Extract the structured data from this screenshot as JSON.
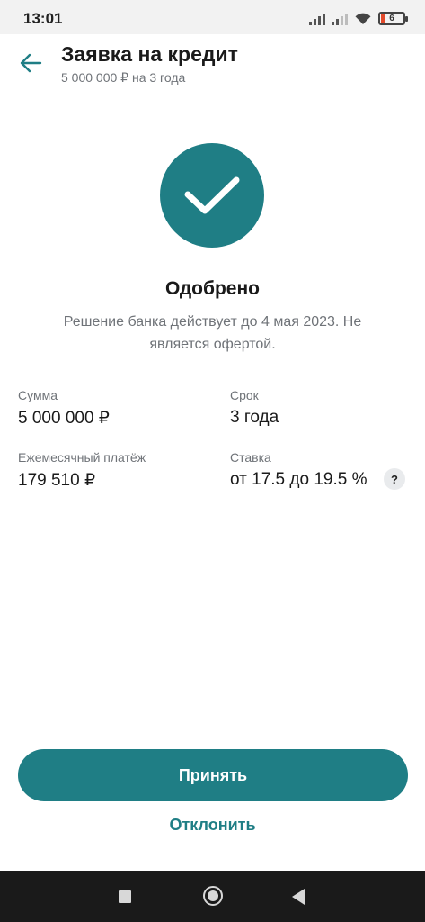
{
  "status_bar": {
    "time": "13:01",
    "battery_level": "6",
    "icons": [
      "signal-icon",
      "signal-weak-icon",
      "wifi-icon",
      "battery-icon"
    ]
  },
  "header": {
    "back_icon": "arrow-left-icon",
    "title": "Заявка на кредит",
    "subtitle": "5 000 000 ₽ на 3 года"
  },
  "status": {
    "icon": "checkmark-icon",
    "heading": "Одобрено",
    "description": "Решение банка действует до 4 мая 2023. Не является офертой."
  },
  "details": {
    "amount": {
      "label": "Сумма",
      "value": "5 000 000 ₽"
    },
    "term": {
      "label": "Срок",
      "value": "3 года"
    },
    "monthly_payment": {
      "label": "Ежемесячный платёж",
      "value": "179 510 ₽"
    },
    "rate": {
      "label": "Ставка",
      "value": "от 17.5 до 19.5 %",
      "help": "?"
    }
  },
  "actions": {
    "accept_label": "Принять",
    "decline_label": "Отклонить"
  },
  "colors": {
    "accent": "#1f7e85",
    "text_primary": "#1a1a1a",
    "text_secondary": "#6f7378"
  }
}
